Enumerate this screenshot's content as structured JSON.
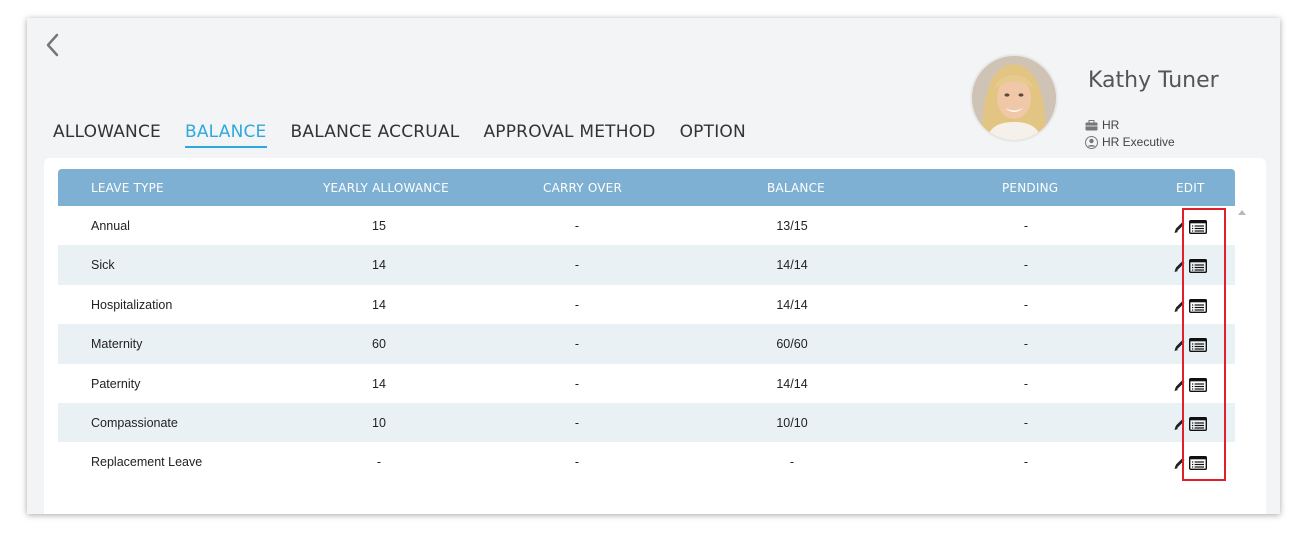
{
  "profile": {
    "name": "Kathy Tuner",
    "department": "HR",
    "position": "HR Executive"
  },
  "tabs": [
    {
      "label": "ALLOWANCE",
      "active": false
    },
    {
      "label": "BALANCE",
      "active": true
    },
    {
      "label": "BALANCE ACCRUAL",
      "active": false
    },
    {
      "label": "APPROVAL METHOD",
      "active": false
    },
    {
      "label": "OPTION",
      "active": false
    }
  ],
  "table": {
    "headers": {
      "leave_type": "LEAVE TYPE",
      "yearly_allowance": "YEARLY ALLOWANCE",
      "carry_over": "CARRY OVER",
      "balance": "BALANCE",
      "pending": "PENDING",
      "edit": "EDIT"
    },
    "rows": [
      {
        "leave_type": "Annual",
        "yearly_allowance": "15",
        "carry_over": "-",
        "balance": "13/15",
        "pending": "-"
      },
      {
        "leave_type": "Sick",
        "yearly_allowance": "14",
        "carry_over": "-",
        "balance": "14/14",
        "pending": "-"
      },
      {
        "leave_type": "Hospitalization",
        "yearly_allowance": "14",
        "carry_over": "-",
        "balance": "14/14",
        "pending": "-"
      },
      {
        "leave_type": "Maternity",
        "yearly_allowance": "60",
        "carry_over": "-",
        "balance": "60/60",
        "pending": "-"
      },
      {
        "leave_type": "Paternity",
        "yearly_allowance": "14",
        "carry_over": "-",
        "balance": "14/14",
        "pending": "-"
      },
      {
        "leave_type": "Compassionate",
        "yearly_allowance": "10",
        "carry_over": "-",
        "balance": "10/10",
        "pending": "-"
      },
      {
        "leave_type": "Replacement Leave",
        "yearly_allowance": "-",
        "carry_over": "-",
        "balance": "-",
        "pending": "-"
      }
    ]
  },
  "icons": {
    "back": "chevron-left-icon",
    "department": "briefcase-icon",
    "position": "user-circle-icon",
    "edit": "pencil-icon",
    "details": "list-icon"
  },
  "colors": {
    "accent": "#2fa8dd",
    "table_header": "#7db0d3",
    "row_alt": "#eaf1f5",
    "highlight": "#e0202a"
  }
}
